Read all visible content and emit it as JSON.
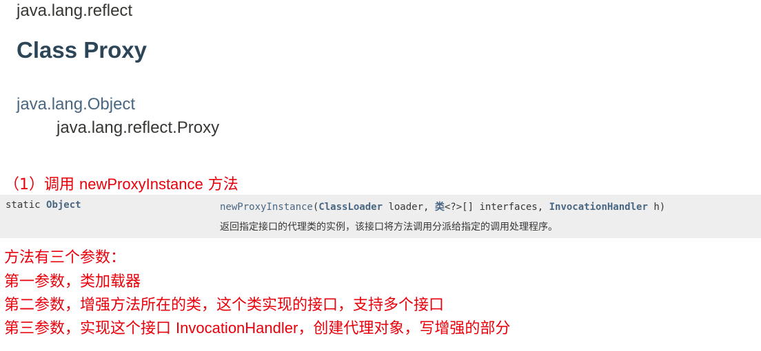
{
  "package_name": "java.lang.reflect",
  "class_title": "Class Proxy",
  "inheritance": {
    "parent": "java.lang.Object",
    "child": "java.lang.reflect.Proxy"
  },
  "step": {
    "prefix": "（1）调用 ",
    "method": "newProxyInstance",
    "suffix": " 方法"
  },
  "method_summary": {
    "modifier": "static",
    "return_type": "Object",
    "method_name": "newProxyInstance",
    "open_paren": "(",
    "param1_type": "ClassLoader",
    "param1_name": " loader, ",
    "param2_type": "类",
    "param2_rest": "<?>[] interfaces, ",
    "param3_type": "InvocationHandler",
    "param3_name": " h)",
    "description": "返回指定接口的代理类的实例，该接口将方法调用分派给指定的调用处理程序。"
  },
  "notes": {
    "line1": "方法有三个参数：",
    "line2": "第一参数，类加载器",
    "line3": "第二参数，增强方法所在的类，这个类实现的接口，支持多个接口",
    "line4_prefix": "第三参数，实现这个接口 ",
    "line4_code": "InvocationHandler",
    "line4_suffix": "，创建代理对象，写增强的部分"
  },
  "colors": {
    "red_annotation": "#e8000b",
    "link_blue": "#4a6782",
    "title_dark": "#2c4557",
    "row_bg": "#eeeeef"
  }
}
